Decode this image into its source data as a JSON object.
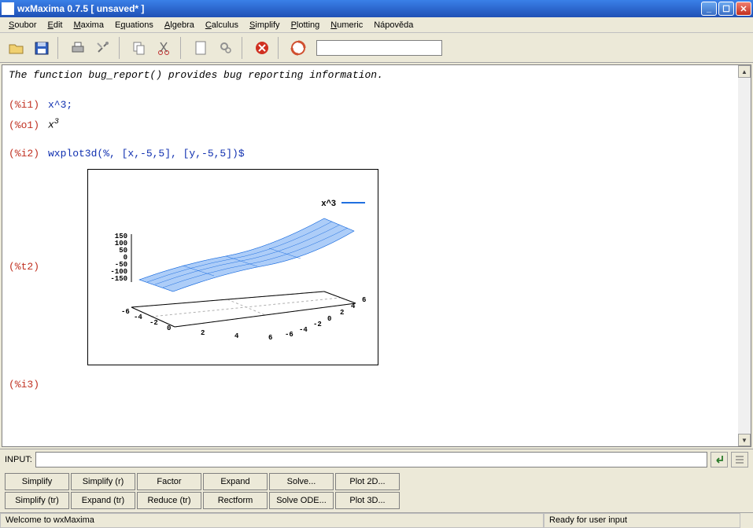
{
  "window": {
    "title": "wxMaxima 0.7.5 [ unsaved* ]"
  },
  "menu": {
    "items": [
      "Soubor",
      "Edit",
      "Maxima",
      "Equations",
      "Algebra",
      "Calculus",
      "Simplify",
      "Plotting",
      "Numeric",
      "Nápověda"
    ]
  },
  "toolbar": {
    "icons": [
      "open-icon",
      "save-icon",
      "print-icon",
      "prefs-icon",
      "copy-icon",
      "cut-icon",
      "new-icon",
      "gear-icon",
      "stop-icon",
      "help-icon"
    ]
  },
  "doc": {
    "intro": "The function bug_report() provides bug reporting information.",
    "lines": [
      {
        "label": "(%i1)",
        "kind": "in",
        "text": "x^3;"
      },
      {
        "label": "(%o1)",
        "kind": "out",
        "base": "x",
        "sup": "3"
      },
      {
        "label": "(%i2)",
        "kind": "in",
        "text": "wxplot3d(%, [x,-5,5], [y,-5,5])$"
      },
      {
        "label": "(%t2)",
        "kind": "plot"
      },
      {
        "label": "(%i3)",
        "kind": "in",
        "text": ""
      }
    ]
  },
  "chart_data": {
    "type": "surface3d",
    "legend": "x^3",
    "x_range": [
      -6,
      6
    ],
    "y_range": [
      -6,
      6
    ],
    "z_ticks": [
      -150,
      -100,
      -50,
      0,
      50,
      100,
      150
    ],
    "x_ticks": [
      -6,
      -4,
      -2,
      0,
      2,
      4,
      6
    ],
    "y_ticks": [
      -6,
      -4,
      -2,
      0,
      2,
      4,
      6
    ],
    "function": "z = x^3"
  },
  "input": {
    "label": "INPUT:",
    "value": ""
  },
  "buttons": {
    "row1": [
      "Simplify",
      "Simplify (r)",
      "Factor",
      "Expand",
      "Solve...",
      "Plot 2D..."
    ],
    "row2": [
      "Simplify (tr)",
      "Expand (tr)",
      "Reduce (tr)",
      "Rectform",
      "Solve ODE...",
      "Plot 3D..."
    ]
  },
  "status": {
    "left": "Welcome to wxMaxima",
    "right": "Ready for user input"
  }
}
